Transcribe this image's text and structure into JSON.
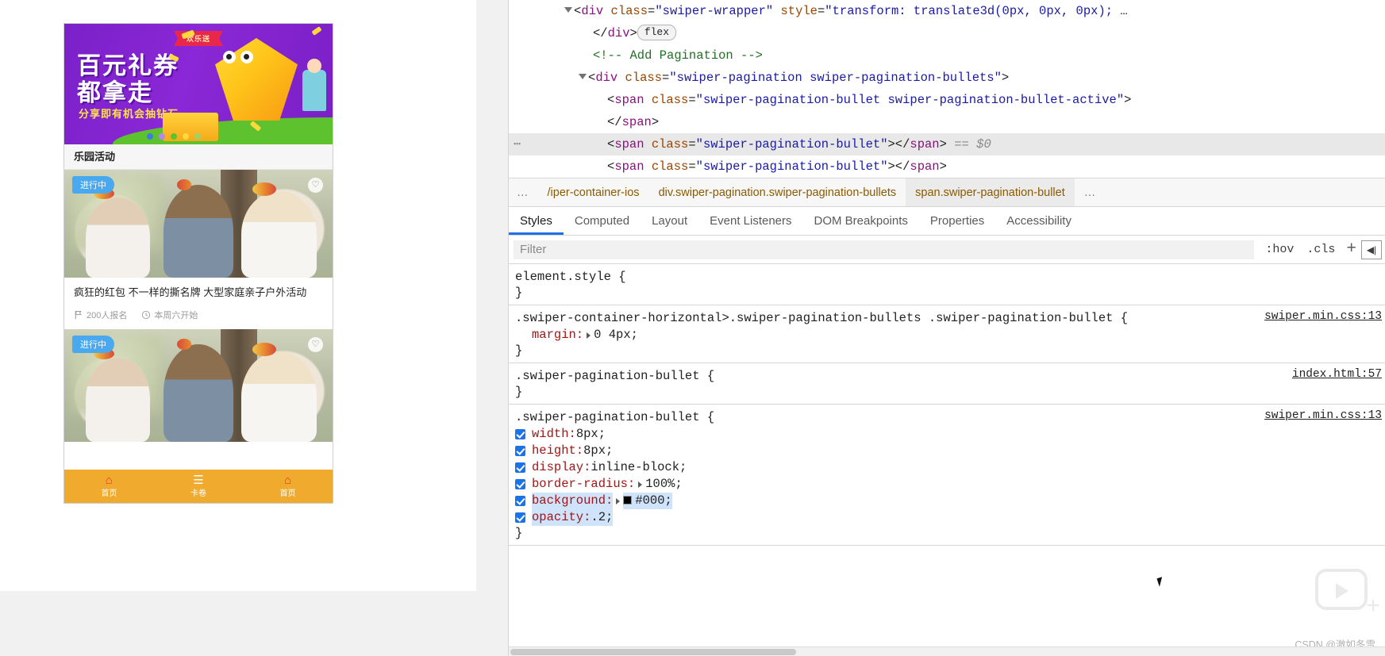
{
  "preview": {
    "banner": {
      "ribbon": "欢乐送",
      "line1": "百元礼券",
      "line2": "都拿走",
      "subtitle": "分享即有机会抽钻石",
      "dot_colors": [
        "#3c7ee0",
        "#b388e8",
        "#5ec12e",
        "#ffd83b",
        "#9fd36a"
      ]
    },
    "section_title": "乐园活动",
    "cards": [
      {
        "badge": "进行中",
        "favorite_icon": "heart-icon",
        "title": "疯狂的红包 不一样的撕名牌 大型家庭亲子户外活动",
        "signups": "200人报名",
        "signups_icon": "flag-icon",
        "start": "本周六开始",
        "start_icon": "clock-icon"
      },
      {
        "badge": "进行中",
        "favorite_icon": "heart-icon",
        "title": "",
        "signups": "",
        "start": ""
      }
    ],
    "tabbar": [
      {
        "icon": "home-icon",
        "glyph": "⌂",
        "label": "首页"
      },
      {
        "icon": "ticket-icon",
        "glyph": "☰",
        "label": "卡卷"
      },
      {
        "icon": "home-icon",
        "glyph": "⌂",
        "label": "首页"
      }
    ]
  },
  "devtools": {
    "dom_lines": [
      {
        "id": "swiper-wrapper",
        "parts": [
          {
            "t": "caret-down",
            "text": ""
          },
          {
            "t": "punct",
            "text": "<"
          },
          {
            "t": "tag",
            "text": "div"
          },
          {
            "t": "attr",
            "text": " class"
          },
          {
            "t": "punct",
            "text": "="
          },
          {
            "t": "val",
            "text": "\"swiper-wrapper\""
          },
          {
            "t": "attr",
            "text": " style"
          },
          {
            "t": "punct",
            "text": "="
          },
          {
            "t": "val",
            "text": "\"transform: translate3d(0px, 0px, 0px);"
          },
          {
            "t": "punct",
            "text": " …"
          }
        ]
      },
      {
        "id": "wrapper-close",
        "indent": 2,
        "parts": [
          {
            "t": "punct",
            "text": "</"
          },
          {
            "t": "tag",
            "text": "div"
          },
          {
            "t": "punct",
            "text": ">"
          },
          {
            "t": "badge",
            "text": "flex"
          }
        ]
      },
      {
        "id": "comment-pagination",
        "indent": 2,
        "parts": [
          {
            "t": "comment",
            "text": "<!-- Add Pagination -->"
          }
        ]
      },
      {
        "id": "pagination-div",
        "indent": 1,
        "parts": [
          {
            "t": "caret-down",
            "text": ""
          },
          {
            "t": "punct",
            "text": "<"
          },
          {
            "t": "tag",
            "text": "div"
          },
          {
            "t": "attr",
            "text": " class"
          },
          {
            "t": "punct",
            "text": "="
          },
          {
            "t": "val",
            "text": "\"swiper-pagination swiper-pagination-bullets\""
          },
          {
            "t": "punct",
            "text": ">"
          }
        ]
      },
      {
        "id": "bullet-active",
        "indent": 3,
        "parts": [
          {
            "t": "punct",
            "text": "<"
          },
          {
            "t": "tag",
            "text": "span"
          },
          {
            "t": "attr",
            "text": " class"
          },
          {
            "t": "punct",
            "text": "="
          },
          {
            "t": "val",
            "text": "\"swiper-pagination-bullet swiper-pagination-bullet-active\""
          },
          {
            "t": "punct",
            "text": ">"
          }
        ]
      },
      {
        "id": "bullet-active-close",
        "indent": 3,
        "parts": [
          {
            "t": "punct",
            "text": "</"
          },
          {
            "t": "tag",
            "text": "span"
          },
          {
            "t": "punct",
            "text": ">"
          }
        ]
      },
      {
        "id": "bullet-selected",
        "indent": 3,
        "selected": true,
        "ellipsis": "⋯",
        "parts": [
          {
            "t": "punct",
            "text": "<"
          },
          {
            "t": "tag",
            "text": "span"
          },
          {
            "t": "attr",
            "text": " class"
          },
          {
            "t": "punct",
            "text": "="
          },
          {
            "t": "val",
            "text": "\"swiper-pagination-bullet\""
          },
          {
            "t": "punct",
            "text": "></"
          },
          {
            "t": "tag",
            "text": "span"
          },
          {
            "t": "punct",
            "text": ">"
          },
          {
            "t": "dollar",
            "text": " == $0"
          }
        ]
      },
      {
        "id": "bullet-next",
        "indent": 3,
        "parts": [
          {
            "t": "punct",
            "text": "<"
          },
          {
            "t": "tag",
            "text": "span"
          },
          {
            "t": "attr",
            "text": " class"
          },
          {
            "t": "punct",
            "text": "="
          },
          {
            "t": "val",
            "text": "\"swiper-pagination-bullet\""
          },
          {
            "t": "punct",
            "text": "></"
          },
          {
            "t": "tag",
            "text": "span"
          },
          {
            "t": "punct",
            "text": ">"
          }
        ]
      }
    ],
    "breadcrumb": [
      {
        "label": "…",
        "kind": "ellipsis"
      },
      {
        "label": "/iper-container-ios",
        "kind": "normal"
      },
      {
        "label": "div.swiper-pagination.swiper-pagination-bullets",
        "kind": "normal"
      },
      {
        "label": "span.swiper-pagination-bullet",
        "kind": "active"
      },
      {
        "label": "…",
        "kind": "tail"
      }
    ],
    "tabs": [
      {
        "label": "Styles",
        "active": true
      },
      {
        "label": "Computed",
        "active": false
      },
      {
        "label": "Layout",
        "active": false
      },
      {
        "label": "Event Listeners",
        "active": false
      },
      {
        "label": "DOM Breakpoints",
        "active": false
      },
      {
        "label": "Properties",
        "active": false
      },
      {
        "label": "Accessibility",
        "active": false
      }
    ],
    "filter": {
      "placeholder": "Filter",
      "value": "",
      "hov_label": ":hov",
      "cls_label": ".cls",
      "new_rule_label": "+",
      "toggle_panel_icon": "panel-toggle-icon"
    },
    "rules": [
      {
        "selector": "element.style",
        "source": "",
        "declarations": []
      },
      {
        "selector": ".swiper-container-horizontal>.swiper-pagination-bullets .swiper-pagination-bullet",
        "source": "swiper.min.css:13",
        "declarations": [
          {
            "checkbox": false,
            "prop": "margin",
            "expandable": true,
            "value": "0 4px",
            "highlight": false
          }
        ]
      },
      {
        "selector": ".swiper-pagination-bullet",
        "source": "index.html:57",
        "declarations": []
      },
      {
        "selector": ".swiper-pagination-bullet",
        "source": "swiper.min.css:13",
        "declarations": [
          {
            "checkbox": true,
            "prop": "width",
            "expandable": false,
            "value": "8px",
            "highlight": false
          },
          {
            "checkbox": true,
            "prop": "height",
            "expandable": false,
            "value": "8px",
            "highlight": false
          },
          {
            "checkbox": true,
            "prop": "display",
            "expandable": false,
            "value": "inline-block",
            "highlight": false
          },
          {
            "checkbox": true,
            "prop": "border-radius",
            "expandable": true,
            "value": "100%",
            "highlight": false
          },
          {
            "checkbox": true,
            "prop": "background",
            "expandable": true,
            "value": "#000",
            "swatch": "#000000",
            "highlight": true
          },
          {
            "checkbox": true,
            "prop": "opacity",
            "expandable": false,
            "value": ".2",
            "highlight": true
          }
        ]
      }
    ],
    "watermark": "CSDN @澈如冬雪"
  }
}
